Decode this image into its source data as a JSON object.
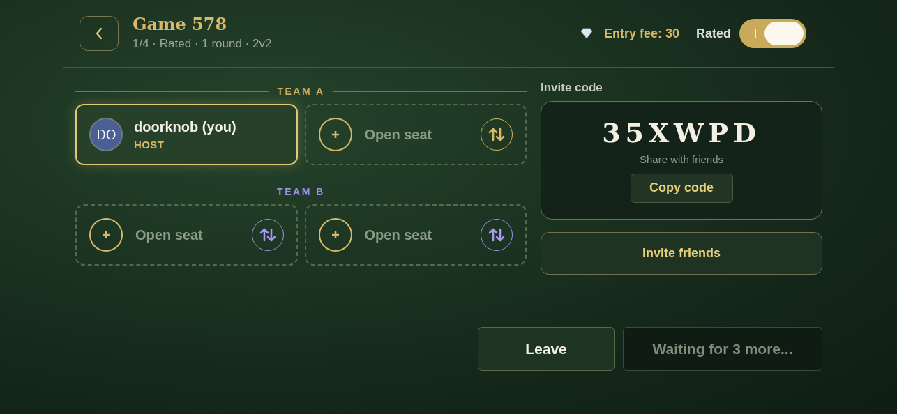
{
  "header": {
    "title": "Game 578",
    "subtitle": "1/4 · Rated · 1 round · 2v2",
    "entry_fee": "Entry fee: 30",
    "rated_label": "Rated",
    "rated_on": true
  },
  "teams": [
    {
      "label": "TEAM A",
      "color": "#c9a95a",
      "seats": [
        {
          "kind": "player",
          "initials": "DO",
          "name": "doorknob (you)",
          "role": "HOST"
        },
        {
          "kind": "open",
          "label": "Open seat"
        }
      ]
    },
    {
      "label": "TEAM B",
      "color": "#9d8fe8",
      "seats": [
        {
          "kind": "open",
          "label": "Open seat"
        },
        {
          "kind": "open",
          "label": "Open seat"
        }
      ]
    }
  ],
  "invite": {
    "heading": "Invite code",
    "code": "35XWPD",
    "hint": "Share with friends",
    "copy_button": "Copy code",
    "invite_button": "Invite friends"
  },
  "footer": {
    "leave_button": "Leave",
    "start_button": {
      "label": "Waiting for 3 more...",
      "disabled": true
    }
  }
}
